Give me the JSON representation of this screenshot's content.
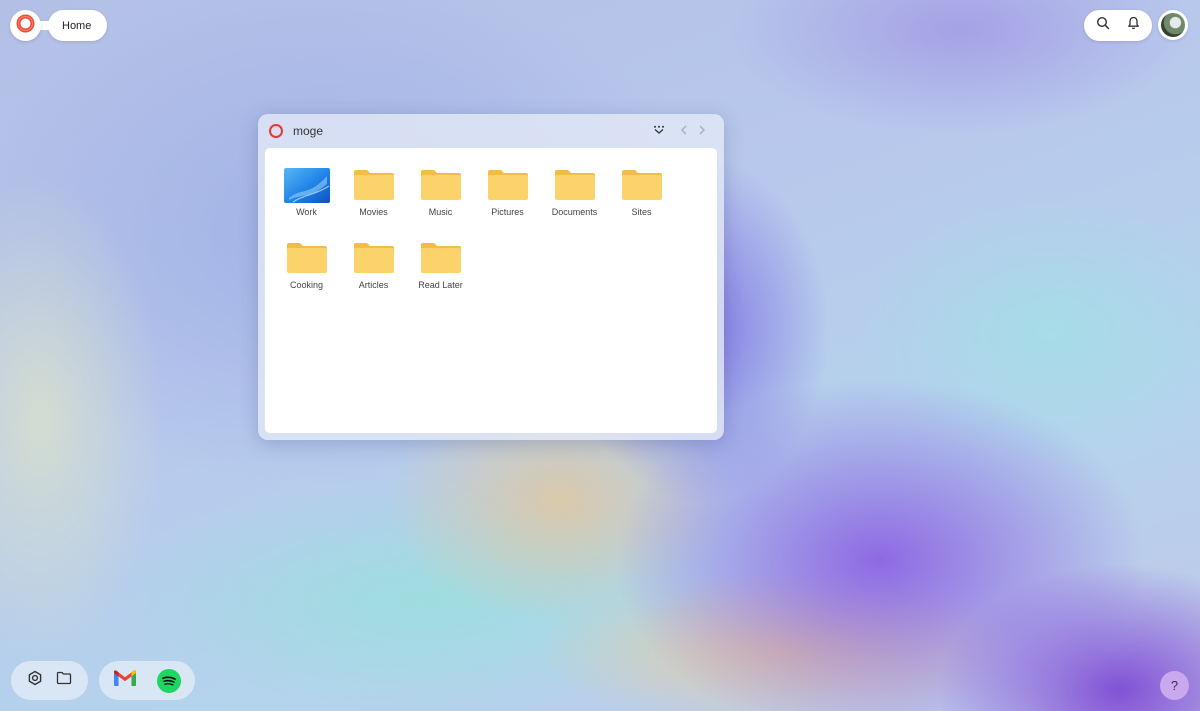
{
  "topbar": {
    "logo_icon": "opera-ring-icon",
    "home_label": "Home"
  },
  "tray": {
    "search_icon": "search-icon",
    "notifications_icon": "bell-icon",
    "avatar_icon": "user-avatar"
  },
  "window": {
    "title": "moge",
    "title_icon": "opera-ring-icon",
    "controls": [
      "more-chevron-icon",
      "back-arrow-icon",
      "forward-arrow-icon"
    ],
    "items": [
      {
        "label": "Work",
        "icon": "desktop-folder-icon"
      },
      {
        "label": "Movies",
        "icon": "folder-icon"
      },
      {
        "label": "Music",
        "icon": "folder-icon"
      },
      {
        "label": "Pictures",
        "icon": "folder-icon"
      },
      {
        "label": "Documents",
        "icon": "folder-icon"
      },
      {
        "label": "Sites",
        "icon": "folder-icon"
      },
      {
        "label": "Cooking",
        "icon": "folder-icon"
      },
      {
        "label": "Articles",
        "icon": "folder-icon"
      },
      {
        "label": "Read Later",
        "icon": "folder-icon"
      }
    ]
  },
  "dock": {
    "system_apps": [
      "settings-gear-icon",
      "files-folder-icon"
    ],
    "pinned_apps": [
      "gmail-icon",
      "spotify-icon"
    ]
  },
  "help": {
    "label": "?"
  },
  "colors": {
    "folder": "#fcd26a",
    "folder_dark": "#f3bd45",
    "accent_red": "#e23a33",
    "spotify_green": "#1ed760",
    "help_bg": "#c9a8ee"
  }
}
